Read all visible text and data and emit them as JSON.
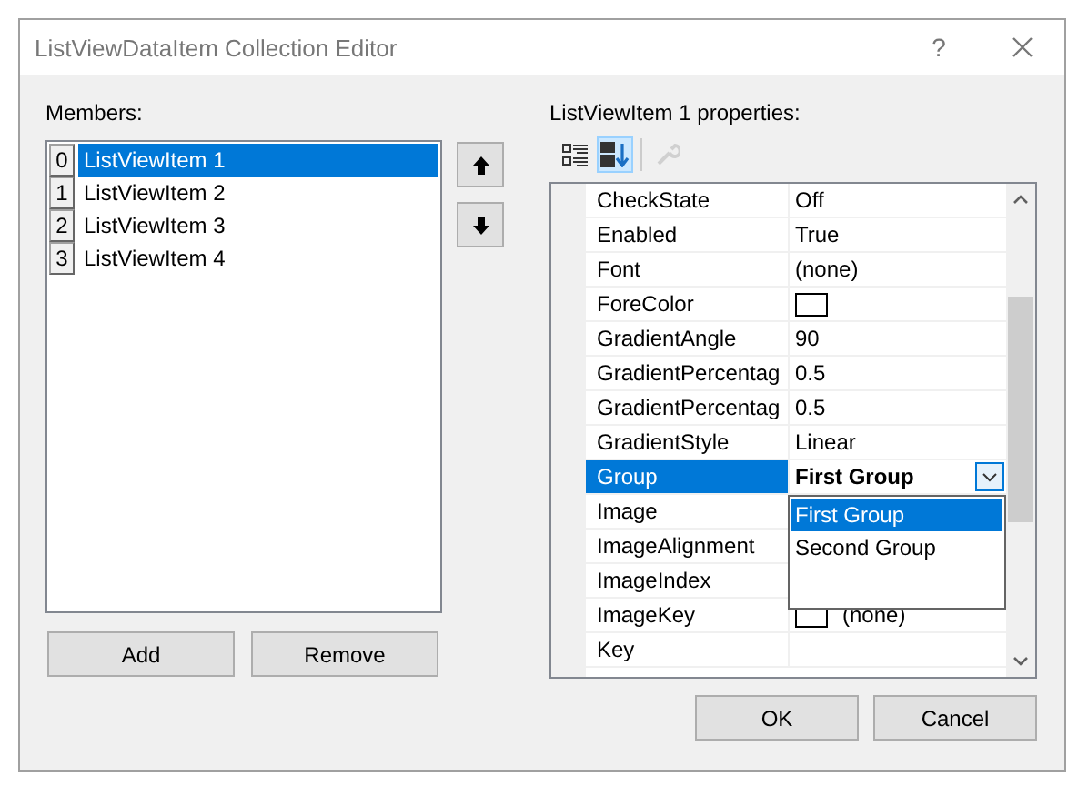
{
  "window": {
    "title": "ListViewDataItem Collection Editor",
    "help": "?"
  },
  "members": {
    "label": "Members:",
    "items": [
      {
        "index": "0",
        "label": "ListViewItem 1",
        "selected": true
      },
      {
        "index": "1",
        "label": "ListViewItem 2",
        "selected": false
      },
      {
        "index": "2",
        "label": "ListViewItem 3",
        "selected": false
      },
      {
        "index": "3",
        "label": "ListViewItem 4",
        "selected": false
      }
    ],
    "buttons": [
      "Add",
      "Remove"
    ]
  },
  "properties": {
    "label": "ListViewItem 1 properties:",
    "toolbar": [
      {
        "kind": "categorized",
        "selected": false,
        "disabled": false
      },
      {
        "kind": "alphabetical",
        "selected": true,
        "disabled": false
      },
      {
        "kind": "pages",
        "selected": false,
        "disabled": true
      }
    ],
    "rows": [
      {
        "name": "CheckState",
        "value": "Off",
        "kind": "text",
        "selected": false
      },
      {
        "name": "Enabled",
        "value": "True",
        "kind": "text",
        "selected": false
      },
      {
        "name": "Font",
        "value": "(none)",
        "kind": "text",
        "selected": false
      },
      {
        "name": "ForeColor",
        "kind": "color",
        "selected": false
      },
      {
        "name": "GradientAngle",
        "value": "90",
        "kind": "text",
        "selected": false
      },
      {
        "name": "GradientPercentag",
        "value": "0.5",
        "kind": "text",
        "selected": false
      },
      {
        "name": "GradientPercentag",
        "value": "0.5",
        "kind": "text",
        "selected": false
      },
      {
        "name": "GradientStyle",
        "value": "Linear",
        "kind": "text",
        "selected": false
      },
      {
        "name": "Group",
        "value": "First Group",
        "kind": "dropdown",
        "selected": true
      },
      {
        "name": "Image",
        "kind": "text",
        "selected": false
      },
      {
        "name": "ImageAlignment",
        "kind": "text",
        "selected": false
      },
      {
        "name": "ImageIndex",
        "kind": "text",
        "selected": false
      },
      {
        "name": "ImageKey",
        "value": "(none)",
        "kind": "image",
        "selected": false
      },
      {
        "name": "Key",
        "kind": "text",
        "selected": false
      }
    ],
    "dropdown": {
      "options": [
        {
          "label": "First Group",
          "selected": true
        },
        {
          "label": "Second Group",
          "selected": false
        }
      ]
    }
  },
  "dialog_buttons": [
    "OK",
    "Cancel"
  ]
}
